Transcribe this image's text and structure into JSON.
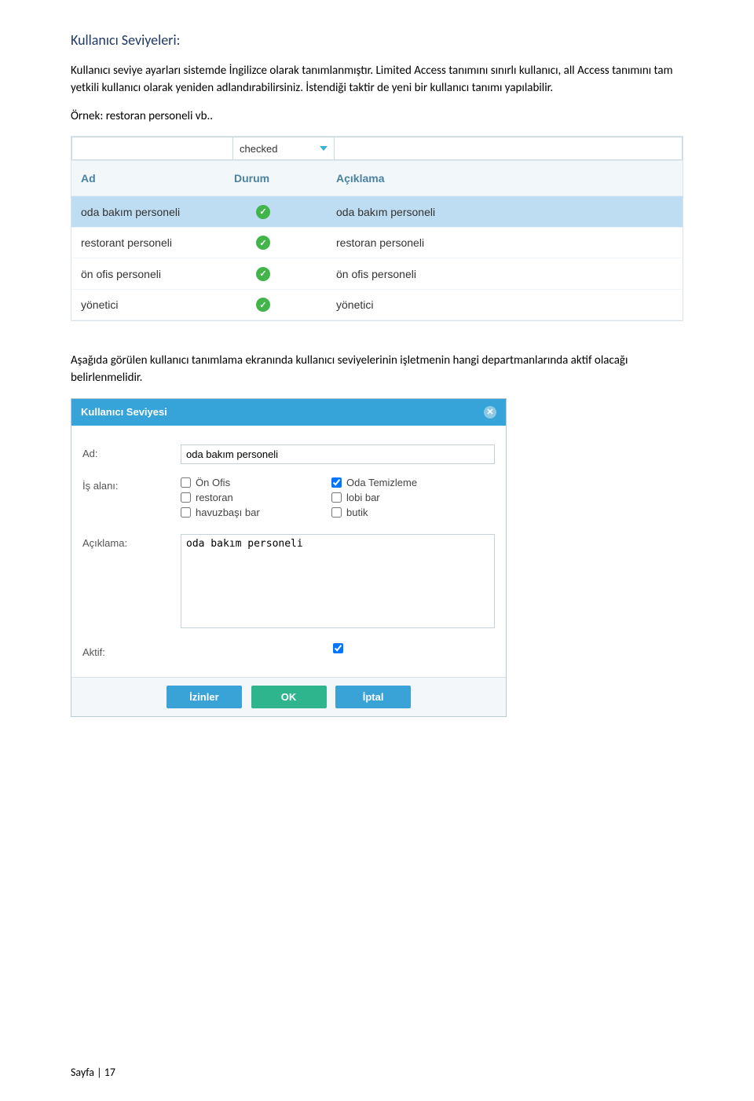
{
  "heading": "Kullanıcı Seviyeleri:",
  "paragraph1": "Kullanıcı seviye ayarları sistemde İngilizce olarak tanımlanmıştır. Limited Access tanımını sınırlı kullanıcı, all Access tanımını tam yetkili kullanıcı olarak yeniden adlandırabilirsiniz. İstendiği  taktir de yeni bir kullanıcı tanımı yapılabilir.",
  "paragraph2": "Örnek: restoran personeli vb..",
  "paragraph3": "Aşağıda görülen kullanıcı tanımlama ekranında kullanıcı seviyelerinin işletmenin hangi departmanlarında aktif olacağı belirlenmelidir.",
  "table": {
    "filterSelect": "checked",
    "headers": {
      "c1": "Ad",
      "c2": "Durum",
      "c3": "Açıklama"
    },
    "rows": [
      {
        "ad": "oda bakım personeli",
        "durum": true,
        "acik": "oda bakım personeli",
        "selected": true
      },
      {
        "ad": "restorant personeli",
        "durum": true,
        "acik": "restoran personeli",
        "selected": false
      },
      {
        "ad": "ön ofis personeli",
        "durum": true,
        "acik": "ön ofis personeli",
        "selected": false
      },
      {
        "ad": "yönetici",
        "durum": true,
        "acik": "yönetici",
        "selected": false
      }
    ]
  },
  "modal": {
    "title": "Kullanıcı Seviyesi",
    "labels": {
      "ad": "Ad:",
      "isalani": "İş alanı:",
      "aciklama": "Açıklama:",
      "aktif": "Aktif:"
    },
    "fields": {
      "ad": "oda bakım personeli",
      "aciklama": "oda bakım personeli",
      "aktif": true
    },
    "checkboxes": [
      {
        "label": "Ön Ofis",
        "checked": false
      },
      {
        "label": "Oda Temizleme",
        "checked": true
      },
      {
        "label": "restoran",
        "checked": false
      },
      {
        "label": "lobi bar",
        "checked": false
      },
      {
        "label": "havuzbaşı bar",
        "checked": false
      },
      {
        "label": "butik",
        "checked": false
      }
    ],
    "buttons": {
      "izinler": "İzinler",
      "ok": "OK",
      "iptal": "İptal"
    }
  },
  "footer": "Sayfa | 17"
}
